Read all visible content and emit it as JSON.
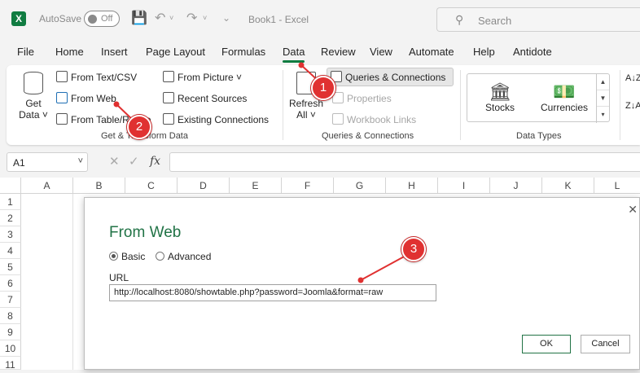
{
  "titlebar": {
    "app_logo": "X",
    "autosave_label": "AutoSave",
    "autosave_state": "Off",
    "doc_title": "Book1  -  Excel",
    "search_placeholder": "Search"
  },
  "menu": {
    "tabs": [
      "File",
      "Home",
      "Insert",
      "Page Layout",
      "Formulas",
      "Data",
      "Review",
      "View",
      "Automate",
      "Help",
      "Antidote"
    ],
    "active_tab": "Data"
  },
  "ribbon": {
    "get_data": {
      "line1": "Get",
      "line2": "Data ˅"
    },
    "from_text_csv": "From Text/CSV",
    "from_web": "From Web",
    "from_table_range": "From Table/Range",
    "from_picture": "From Picture ˅",
    "recent_sources": "Recent Sources",
    "existing_connections": "Existing Connections",
    "group_get_transform": "Get & Transform Data",
    "refresh_all": {
      "line1": "Refresh",
      "line2": "All ˅"
    },
    "queries_connections": "Queries & Connections",
    "properties": "Properties",
    "workbook_links": "Workbook Links",
    "group_queries": "Queries & Connections",
    "stocks": "Stocks",
    "currencies": "Currencies",
    "group_data_types": "Data Types"
  },
  "formula_bar": {
    "name_box": "A1",
    "fx": "fx"
  },
  "grid": {
    "columns": [
      "A",
      "B",
      "C",
      "D",
      "E",
      "F",
      "G",
      "H",
      "I",
      "J",
      "K",
      "L"
    ],
    "rows": [
      "1",
      "2",
      "3",
      "4",
      "5",
      "6",
      "7",
      "8",
      "9",
      "10",
      "11"
    ]
  },
  "dialog": {
    "title": "From Web",
    "radio_basic": "Basic",
    "radio_advanced": "Advanced",
    "selected_mode": "Basic",
    "url_label": "URL",
    "url_value": "http://localhost:8080/showtable.php?password=Joomla&format=raw",
    "ok_label": "OK",
    "cancel_label": "Cancel"
  },
  "annotations": {
    "marker1": "1",
    "marker2": "2",
    "marker3": "3",
    "color": "#e03131"
  }
}
